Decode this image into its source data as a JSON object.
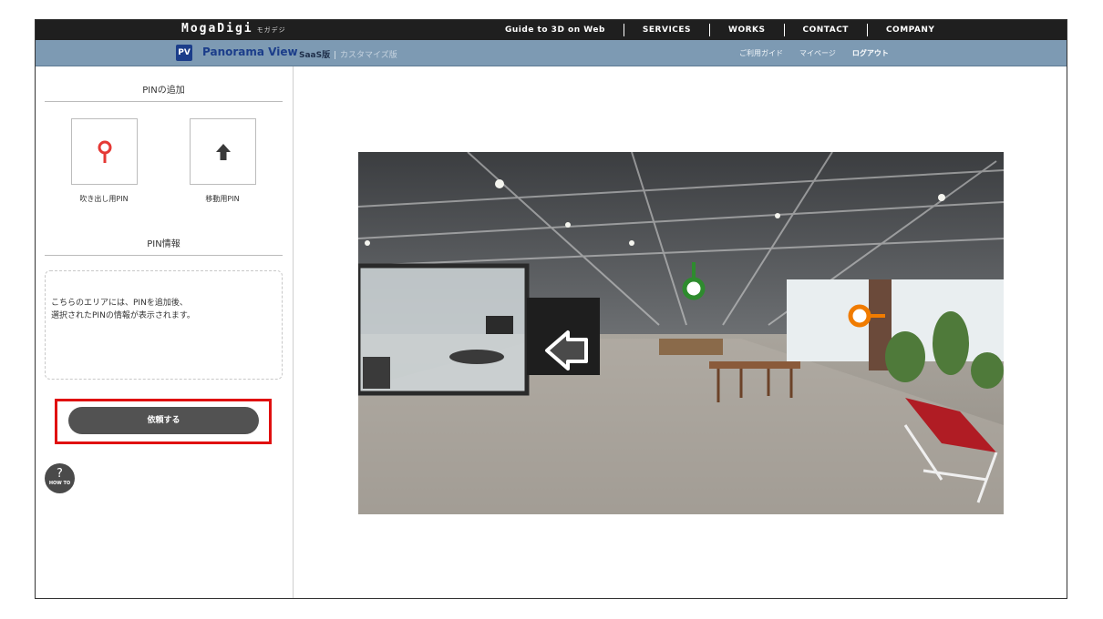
{
  "header": {
    "brand": "MogaDigi",
    "brand_kana": "モガデジ",
    "nav": [
      "Guide to 3D on Web",
      "SERVICES",
      "WORKS",
      "CONTACT",
      "COMPANY"
    ]
  },
  "subheader": {
    "logo_text": "PV",
    "product_name": "Panorama View",
    "edition_saas": "SaaS版",
    "edition_custom": "カスタマイズ版",
    "links": [
      "ご利用ガイド",
      "マイページ",
      "ログアウト"
    ]
  },
  "sidebar": {
    "add_title": "PINの追加",
    "pins": [
      {
        "label": "吹き出し用PIN",
        "icon": "map-pin-icon",
        "color": "#e53935"
      },
      {
        "label": "移動用PIN",
        "icon": "arrow-up-icon",
        "color": "#3a3a3a"
      }
    ],
    "info_title": "PIN情報",
    "info_lines": [
      "こちらのエリアには、PINを追加後、",
      "選択されたPINの情報が表示されます。"
    ],
    "request_button": "依頼する",
    "howto_q": "?",
    "howto_label": "HOW TO"
  },
  "colors": {
    "header_bg": "#1f1f1f",
    "subheader_bg": "#7d9ab3",
    "brand_blue": "#1b3d8a",
    "highlight_red": "#e01010",
    "button_bg": "#525252",
    "pin_green": "#2e8b2e",
    "pin_orange": "#f07b00"
  },
  "panorama": {
    "scene": "office interior 360 view",
    "pins": [
      {
        "type": "callout",
        "color": "green"
      },
      {
        "type": "callout",
        "color": "orange"
      },
      {
        "type": "move",
        "direction": "left"
      }
    ]
  }
}
